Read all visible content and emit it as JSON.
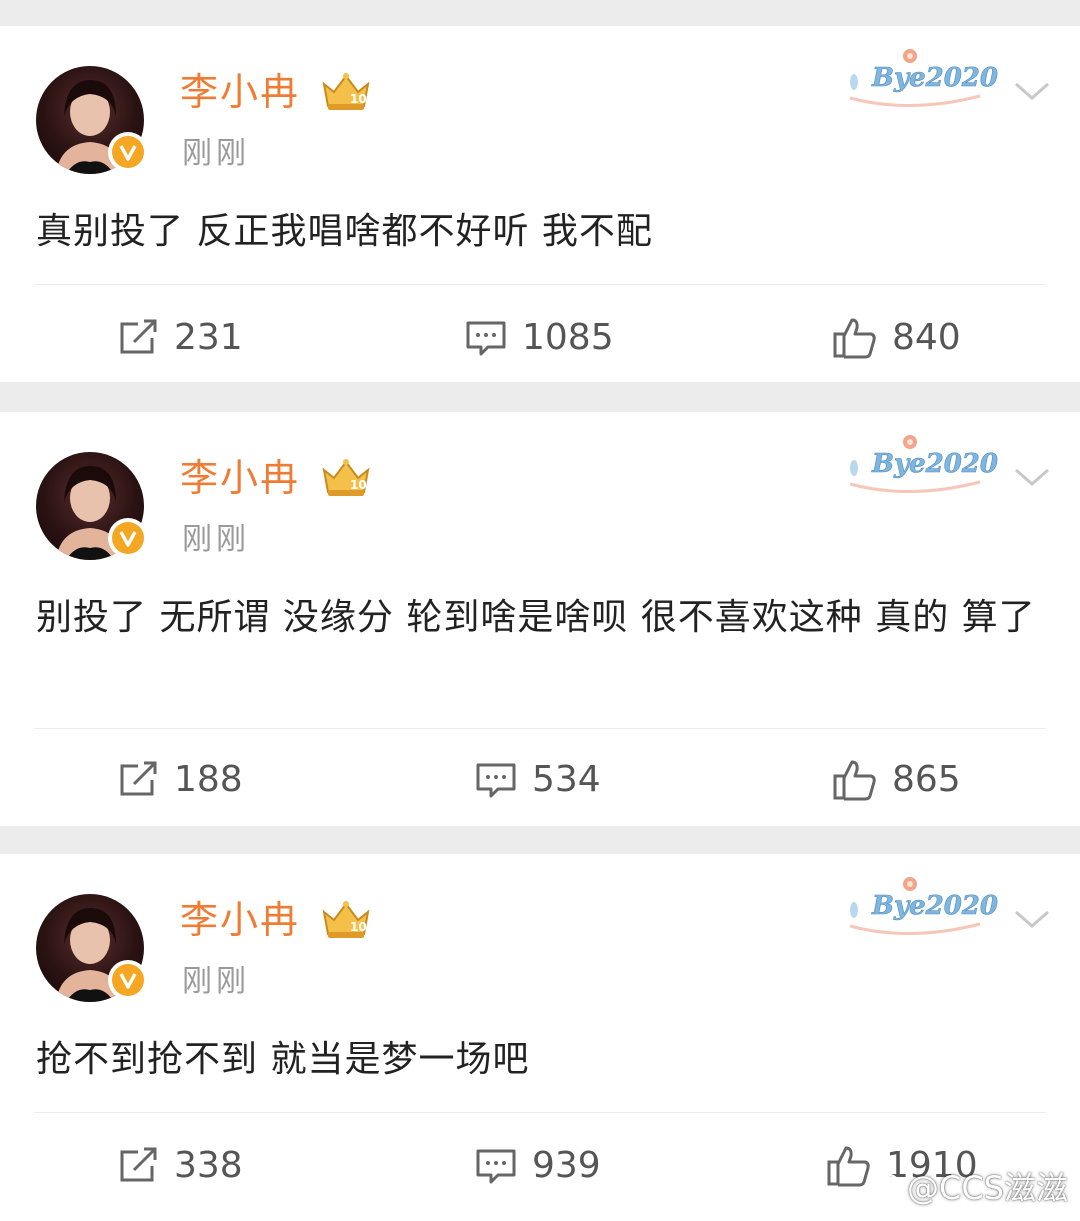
{
  "colors": {
    "username": "#f07c33",
    "badge": "#f5a623",
    "background": "#ececec"
  },
  "posts": [
    {
      "author": "李小冉",
      "time": "刚刚",
      "badge_text": "Bye2020",
      "crown_level": "10",
      "content": "真别投了 反正我唱啥都不好听 我不配",
      "reposts": "231",
      "comments": "1085",
      "likes": "840"
    },
    {
      "author": "李小冉",
      "time": "刚刚",
      "badge_text": "Bye2020",
      "crown_level": "10",
      "content": "别投了 无所谓 没缘分 轮到啥是啥呗 很不喜欢这种 真的  算了",
      "reposts": "188",
      "comments": "534",
      "likes": "865"
    },
    {
      "author": "李小冉",
      "time": "刚刚",
      "badge_text": "Bye2020",
      "crown_level": "10",
      "content": "抢不到抢不到 就当是梦一场吧",
      "reposts": "338",
      "comments": "939",
      "likes": "1910"
    }
  ],
  "watermark": {
    "text": "@CCS滋滋",
    "icon": "weibo-icon"
  },
  "icons": {
    "repost": "repost-icon",
    "comment": "comment-icon",
    "like": "thumbs-up-icon",
    "more": "chevron-down-icon",
    "verified": "verified-v-icon",
    "crown": "crown-icon"
  }
}
